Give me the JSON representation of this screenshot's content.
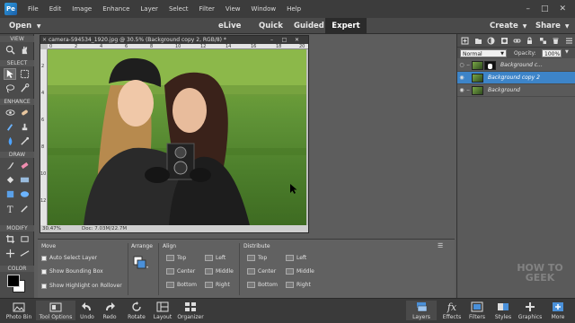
{
  "app": {
    "logo_text": "Pe"
  },
  "menu": [
    "File",
    "Edit",
    "Image",
    "Enhance",
    "Layer",
    "Select",
    "Filter",
    "View",
    "Window",
    "Help"
  ],
  "modes": {
    "open": "Open",
    "elive": "eLive",
    "quick": "Quick",
    "guided": "Guided",
    "expert": "Expert",
    "create": "Create",
    "share": "Share"
  },
  "toolbox": {
    "view": "VIEW",
    "select": "SELECT",
    "enhance": "ENHANCE",
    "draw": "DRAW",
    "modify": "MODIFY",
    "color": "COLOR"
  },
  "document": {
    "title": "camera-594534_1920.jpg @ 30.5% (Background copy 2, RGB/8) *",
    "zoom": "30.47%",
    "doc_size": "Doc: 7.03M/22.7M"
  },
  "rulers": {
    "top": [
      "0",
      "2",
      "4",
      "6",
      "8",
      "10",
      "12",
      "14",
      "16",
      "18",
      "20"
    ],
    "left": [
      "2",
      "4",
      "6",
      "8",
      "10",
      "12"
    ]
  },
  "layers_panel": {
    "blend_mode": "Normal",
    "opacity_label": "Opacity:",
    "opacity_value": "100%",
    "layers": [
      {
        "name": "Background c...",
        "selected": false
      },
      {
        "name": "Background copy 2",
        "selected": true
      },
      {
        "name": "Background",
        "selected": false
      }
    ]
  },
  "tool_options": {
    "move_title": "Move",
    "auto_select": "Auto Select Layer",
    "bounding_box": "Show Bounding Box",
    "highlight": "Show Highlight on Rollover",
    "arrange_title": "Arrange",
    "align_title": "Align",
    "align": {
      "top": "Top",
      "left": "Left",
      "center": "Center",
      "middle": "Middle",
      "bottom": "Bottom",
      "right": "Right"
    },
    "distribute_title": "Distribute",
    "distribute": {
      "top": "Top",
      "left": "Left",
      "center": "Center",
      "middle": "Middle",
      "bottom": "Bottom",
      "right": "Right"
    }
  },
  "bottom_bar": {
    "photo_bin": "Photo Bin",
    "tool_options": "Tool Options",
    "undo": "Undo",
    "redo": "Redo",
    "rotate": "Rotate",
    "layout": "Layout",
    "organizer": "Organizer",
    "layers": "Layers",
    "effects": "Effects",
    "filters": "Filters",
    "styles": "Styles",
    "graphics": "Graphics",
    "more": "More"
  },
  "watermark": {
    "line1": "HOW TO",
    "line2": "GEEK"
  },
  "colors": {
    "accent": "#3d84c8",
    "expert_tab": "#2b2b2b",
    "panel": "#5a5a5a"
  }
}
